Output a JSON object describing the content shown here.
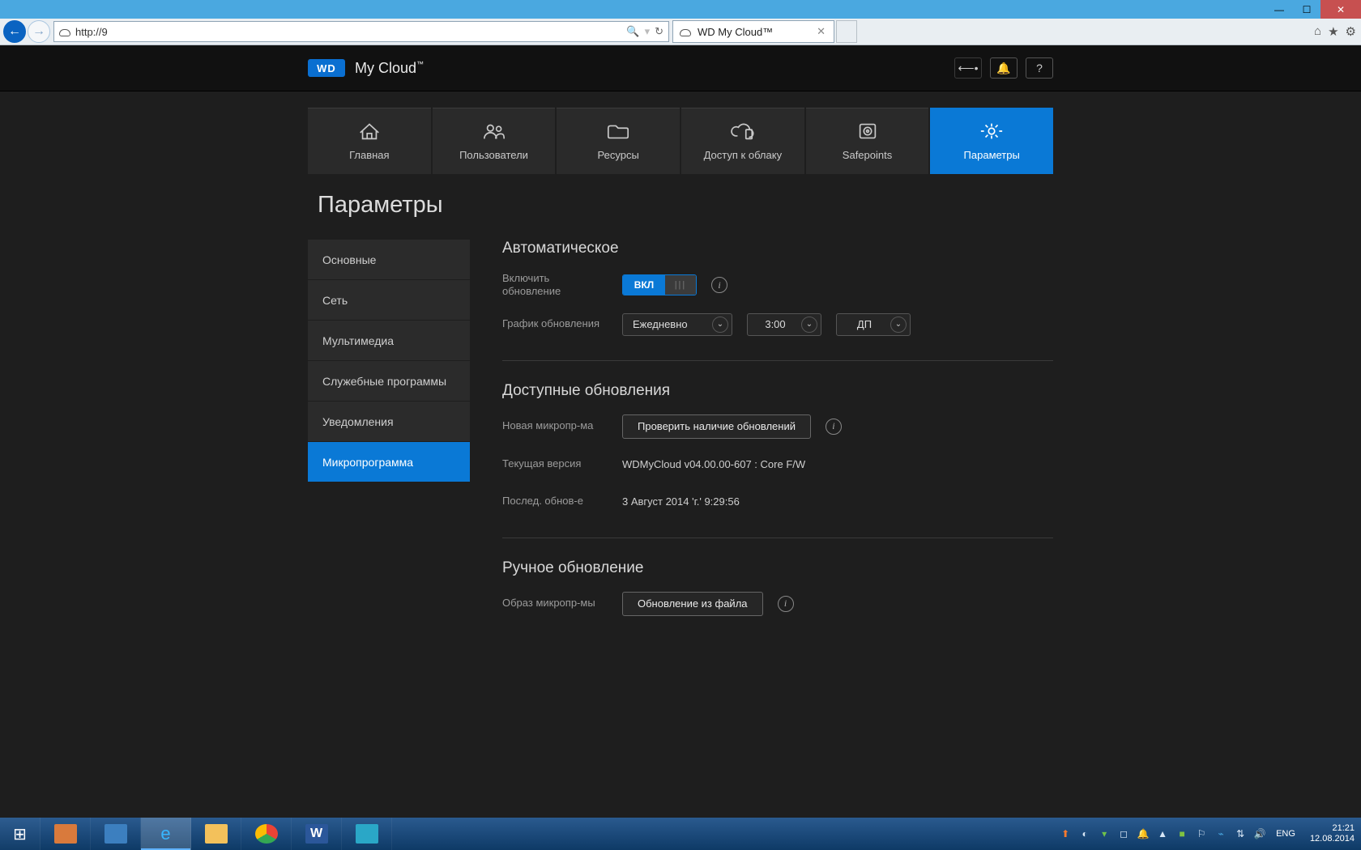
{
  "browser": {
    "url": "http://9",
    "tab_title": "WD My Cloud™"
  },
  "header": {
    "brand_badge": "WD",
    "brand_name": "My Cloud"
  },
  "topnav": [
    {
      "label": "Главная"
    },
    {
      "label": "Пользователи"
    },
    {
      "label": "Ресурсы"
    },
    {
      "label": "Доступ к облаку"
    },
    {
      "label": "Safepoints"
    },
    {
      "label": "Параметры"
    }
  ],
  "page_title": "Параметры",
  "sidebar": [
    {
      "label": "Основные"
    },
    {
      "label": "Сеть"
    },
    {
      "label": "Мультимедиа"
    },
    {
      "label": "Служебные программы"
    },
    {
      "label": "Уведомления"
    },
    {
      "label": "Микропрограмма"
    }
  ],
  "sections": {
    "auto": {
      "title": "Автоматическое",
      "enable_label": "Включить обновление",
      "toggle_on": "ВКЛ",
      "schedule_label": "График обновления",
      "freq": "Ежедневно",
      "time": "3:00",
      "ampm": "ДП"
    },
    "avail": {
      "title": "Доступные обновления",
      "new_fw_label": "Новая микропр-ма",
      "check_btn": "Проверить наличие обновлений",
      "cur_label": "Текущая версия",
      "cur_value": "WDMyCloud v04.00.00-607 : Core F/W",
      "last_label": "Послед. обнов-е",
      "last_value": "3 Август 2014 'г.' 9:29:56"
    },
    "manual": {
      "title": "Ручное обновление",
      "image_label": "Образ микропр-мы",
      "from_file_btn": "Обновление из файла"
    }
  },
  "taskbar": {
    "lang": "ENG",
    "time": "21:21",
    "date": "12.08.2014"
  }
}
